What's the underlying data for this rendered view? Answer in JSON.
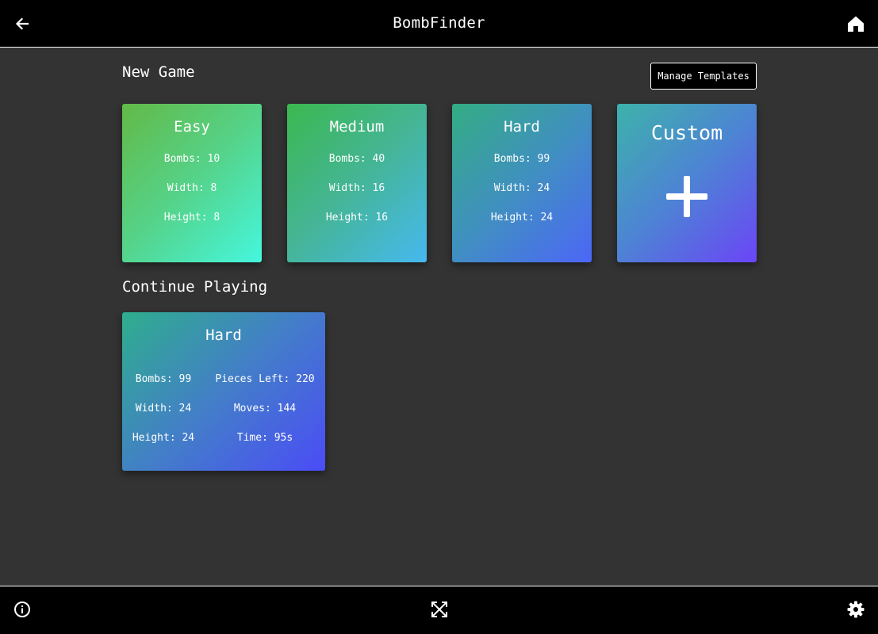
{
  "header": {
    "title": "BombFinder",
    "back_icon": "arrow-left-icon",
    "home_icon": "home-icon"
  },
  "new_game": {
    "title": "New Game",
    "manage_templates_label": "Manage Templates",
    "cards": [
      {
        "title": "Easy",
        "bombs": "Bombs: 10",
        "width": "Width: 8",
        "height": "Height: 8"
      },
      {
        "title": "Medium",
        "bombs": "Bombs: 40",
        "width": "Width: 16",
        "height": "Height: 16"
      },
      {
        "title": "Hard",
        "bombs": "Bombs: 99",
        "width": "Width: 24",
        "height": "Height: 24"
      }
    ],
    "custom": {
      "title": "Custom",
      "icon": "plus-icon"
    }
  },
  "continue_playing": {
    "title": "Continue Playing",
    "games": [
      {
        "title": "Hard",
        "bombs": "Bombs: 99",
        "width": "Width: 24",
        "height": "Height: 24",
        "pieces_left": "Pieces Left: 220",
        "moves": "Moves: 144",
        "time": "Time: 95s"
      }
    ]
  },
  "footer": {
    "info_icon": "info-icon",
    "fullscreen_icon": "fullscreen-icon",
    "settings_icon": "gear-icon"
  },
  "colors": {
    "bar_background": "#000000",
    "page_background": "#333333",
    "text": "#ffffff"
  }
}
